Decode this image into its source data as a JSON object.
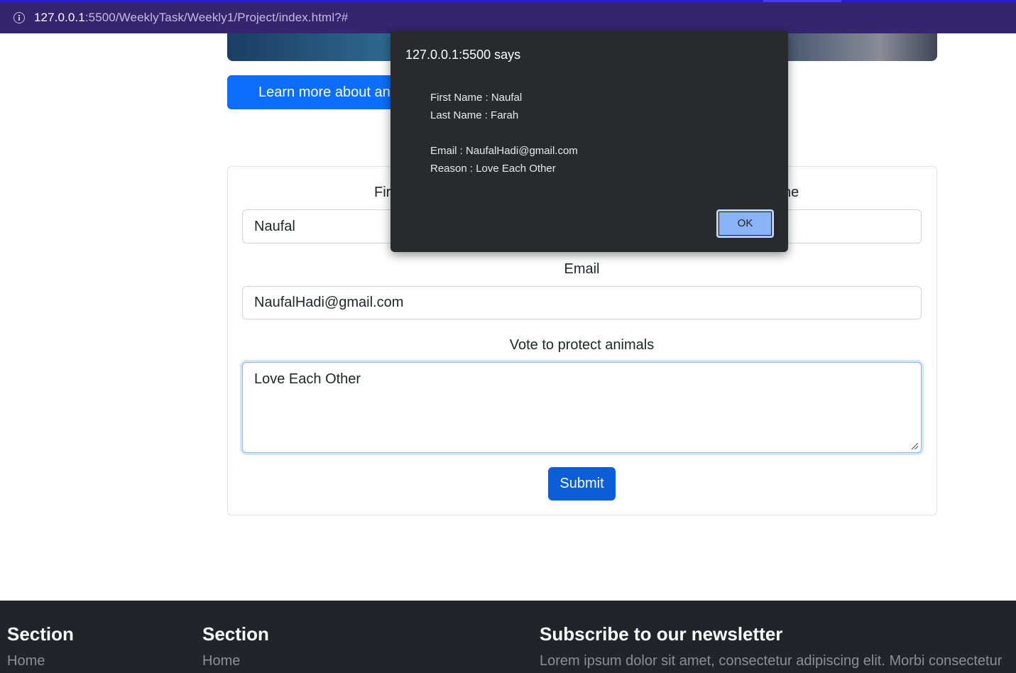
{
  "browser": {
    "url_host": "127.0.0.1",
    "url_rest": ":5500/WeeklyTask/Weekly1/Project/index.html?#"
  },
  "page": {
    "learn_more_label": "Learn more about anima",
    "form": {
      "first_name_label": "Fir",
      "last_name_label": "ne",
      "first_name_value": "Naufal",
      "email_label": "Email",
      "email_value": "NaufalHadi@gmail.com",
      "vote_label": "Vote to protect animals",
      "vote_value": "Love Each Other",
      "submit_label": "Submit"
    }
  },
  "footer": {
    "col1": {
      "heading": "Section",
      "link": "Home"
    },
    "col2": {
      "heading": "Section",
      "link": "Home"
    },
    "newsletter": {
      "heading": "Subscribe to our newsletter",
      "text": "Lorem ipsum dolor sit amet, consectetur adipiscing elit. Morbi consectetur"
    }
  },
  "alert": {
    "title": "127.0.0.1:5500 says",
    "first_name": "First Name : Naufal",
    "last_name": "Last Name : Farah",
    "email": "Email : NaufalHadi@gmail.com",
    "reason": "Reason : Love Each Other",
    "ok_label": "OK"
  }
}
